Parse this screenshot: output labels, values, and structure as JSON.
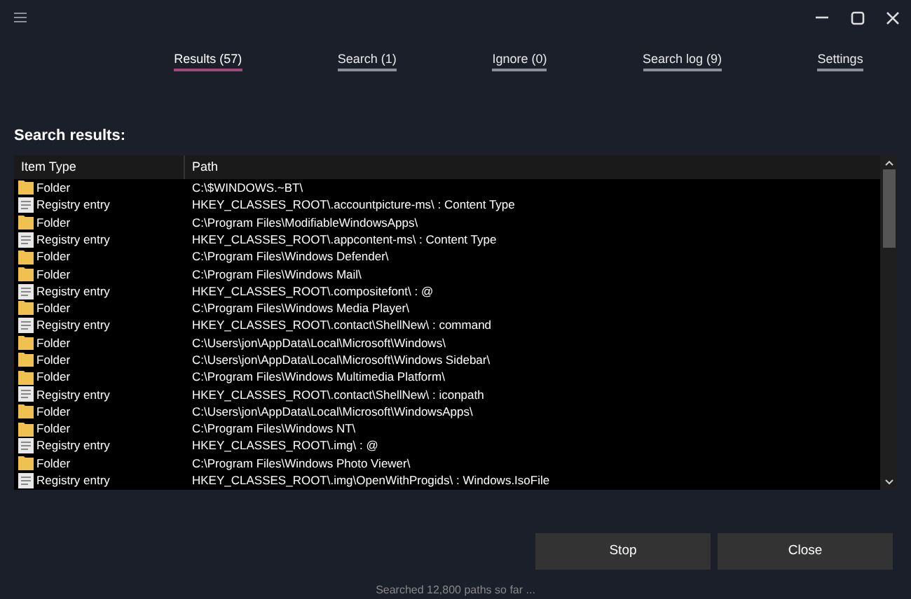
{
  "tabs": [
    {
      "label": "Results (57)",
      "selected": true
    },
    {
      "label": "Search (1)",
      "selected": false
    },
    {
      "label": "Ignore (0)",
      "selected": false
    },
    {
      "label": "Search log (9)",
      "selected": false
    },
    {
      "label": "Settings",
      "selected": false
    }
  ],
  "heading": "Search results:",
  "table": {
    "columns": [
      "Item Type",
      "Path"
    ],
    "rows": [
      {
        "kind": "folder",
        "type": "Folder",
        "path": "C:\\$WINDOWS.~BT\\"
      },
      {
        "kind": "registry",
        "type": "Registry entry",
        "path": "HKEY_CLASSES_ROOT\\.accountpicture-ms\\ : Content Type"
      },
      {
        "kind": "folder",
        "type": "Folder",
        "path": "C:\\Program Files\\ModifiableWindowsApps\\"
      },
      {
        "kind": "registry",
        "type": "Registry entry",
        "path": "HKEY_CLASSES_ROOT\\.appcontent-ms\\ : Content Type"
      },
      {
        "kind": "folder",
        "type": "Folder",
        "path": "C:\\Program Files\\Windows Defender\\"
      },
      {
        "kind": "folder",
        "type": "Folder",
        "path": "C:\\Program Files\\Windows Mail\\"
      },
      {
        "kind": "registry",
        "type": "Registry entry",
        "path": "HKEY_CLASSES_ROOT\\.compositefont\\ : @"
      },
      {
        "kind": "folder",
        "type": "Folder",
        "path": "C:\\Program Files\\Windows Media Player\\"
      },
      {
        "kind": "registry",
        "type": "Registry entry",
        "path": "HKEY_CLASSES_ROOT\\.contact\\ShellNew\\ : command"
      },
      {
        "kind": "folder",
        "type": "Folder",
        "path": "C:\\Users\\jon\\AppData\\Local\\Microsoft\\Windows\\"
      },
      {
        "kind": "folder",
        "type": "Folder",
        "path": "C:\\Users\\jon\\AppData\\Local\\Microsoft\\Windows Sidebar\\"
      },
      {
        "kind": "folder",
        "type": "Folder",
        "path": "C:\\Program Files\\Windows Multimedia Platform\\"
      },
      {
        "kind": "registry",
        "type": "Registry entry",
        "path": "HKEY_CLASSES_ROOT\\.contact\\ShellNew\\ : iconpath"
      },
      {
        "kind": "folder",
        "type": "Folder",
        "path": "C:\\Users\\jon\\AppData\\Local\\Microsoft\\WindowsApps\\"
      },
      {
        "kind": "folder",
        "type": "Folder",
        "path": "C:\\Program Files\\Windows NT\\"
      },
      {
        "kind": "registry",
        "type": "Registry entry",
        "path": "HKEY_CLASSES_ROOT\\.img\\ : @"
      },
      {
        "kind": "folder",
        "type": "Folder",
        "path": "C:\\Program Files\\Windows Photo Viewer\\"
      },
      {
        "kind": "registry",
        "type": "Registry entry",
        "path": "HKEY_CLASSES_ROOT\\.img\\OpenWithProgids\\ : Windows.IsoFile"
      }
    ]
  },
  "buttons": [
    "Stop",
    "Close"
  ],
  "status_bar": "Searched 12,800 paths so far ..."
}
